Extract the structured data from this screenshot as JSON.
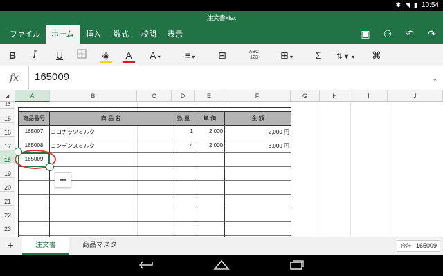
{
  "status": {
    "time": "10:54"
  },
  "title": "注文書xlsx",
  "ribbon": {
    "tabs": [
      "ファイル",
      "ホーム",
      "挿入",
      "数式",
      "校閲",
      "表示"
    ],
    "active_tab": "ホーム"
  },
  "toolbar": {
    "bold": "B",
    "italic": "I",
    "underline": "U",
    "font_color": "A",
    "font_size": "A",
    "spell": "ABC\n123",
    "sum": "Σ"
  },
  "formula": {
    "fx": "fx",
    "value": "165009"
  },
  "columns": [
    "A",
    "B",
    "C",
    "D",
    "E",
    "F",
    "G",
    "H",
    "I",
    "J"
  ],
  "rows": [
    "15",
    "16",
    "17",
    "18",
    "19",
    "20",
    "21",
    "22",
    "23"
  ],
  "partial_row": "13",
  "table": {
    "headers": [
      "商品番号",
      "商 品 名",
      "数 量",
      "単 価",
      "金 額"
    ],
    "rows": [
      [
        "165007",
        "ココナッツミルク",
        "1",
        "2,000",
        "2,000 円"
      ],
      [
        "165008",
        "コンデンスミルク",
        "4",
        "2,000",
        "8,000 円"
      ],
      [
        "165009",
        "",
        "",
        "",
        ""
      ]
    ]
  },
  "context_button": "•••",
  "sheets": {
    "add": "+",
    "tabs": [
      "注文書",
      "商品マスタ"
    ],
    "active": "注文書"
  },
  "summary": {
    "label": "合計",
    "value": "165009"
  },
  "colors": {
    "brand": "#217346",
    "highlight": "#e03030"
  }
}
